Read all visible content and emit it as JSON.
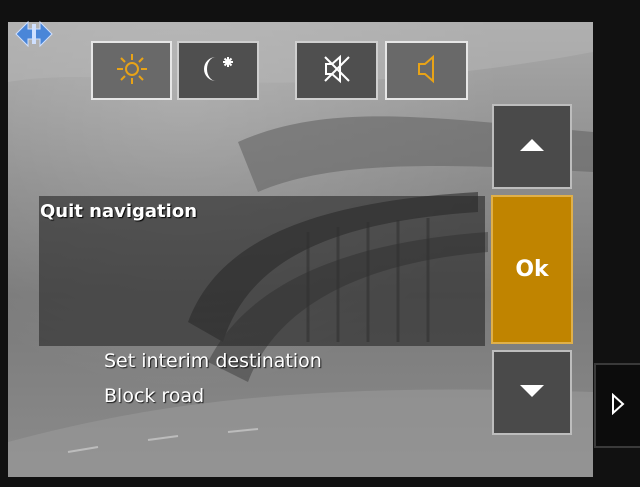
{
  "toolbar": {
    "day_mode": {
      "icon": "sun-icon",
      "active": true
    },
    "night_mode": {
      "icon": "moon-star-icon",
      "active": false
    },
    "mute": {
      "icon": "speaker-muted-icon",
      "active": false
    },
    "sound": {
      "icon": "speaker-icon",
      "active": true
    }
  },
  "menu": {
    "selected": "Quit navigation",
    "items": [
      "Set interim destination",
      "Block road"
    ]
  },
  "buttons": {
    "ok_label": "Ok",
    "up_icon": "arrow-up-icon",
    "down_icon": "arrow-down-icon",
    "next_icon": "chevron-right-icon",
    "move_icon": "move-arrows-icon"
  },
  "colors": {
    "accent": "#c08400",
    "icon_accent": "#e8a317",
    "icon_light": "#ffffff",
    "move_icon": "#4a86d8"
  }
}
